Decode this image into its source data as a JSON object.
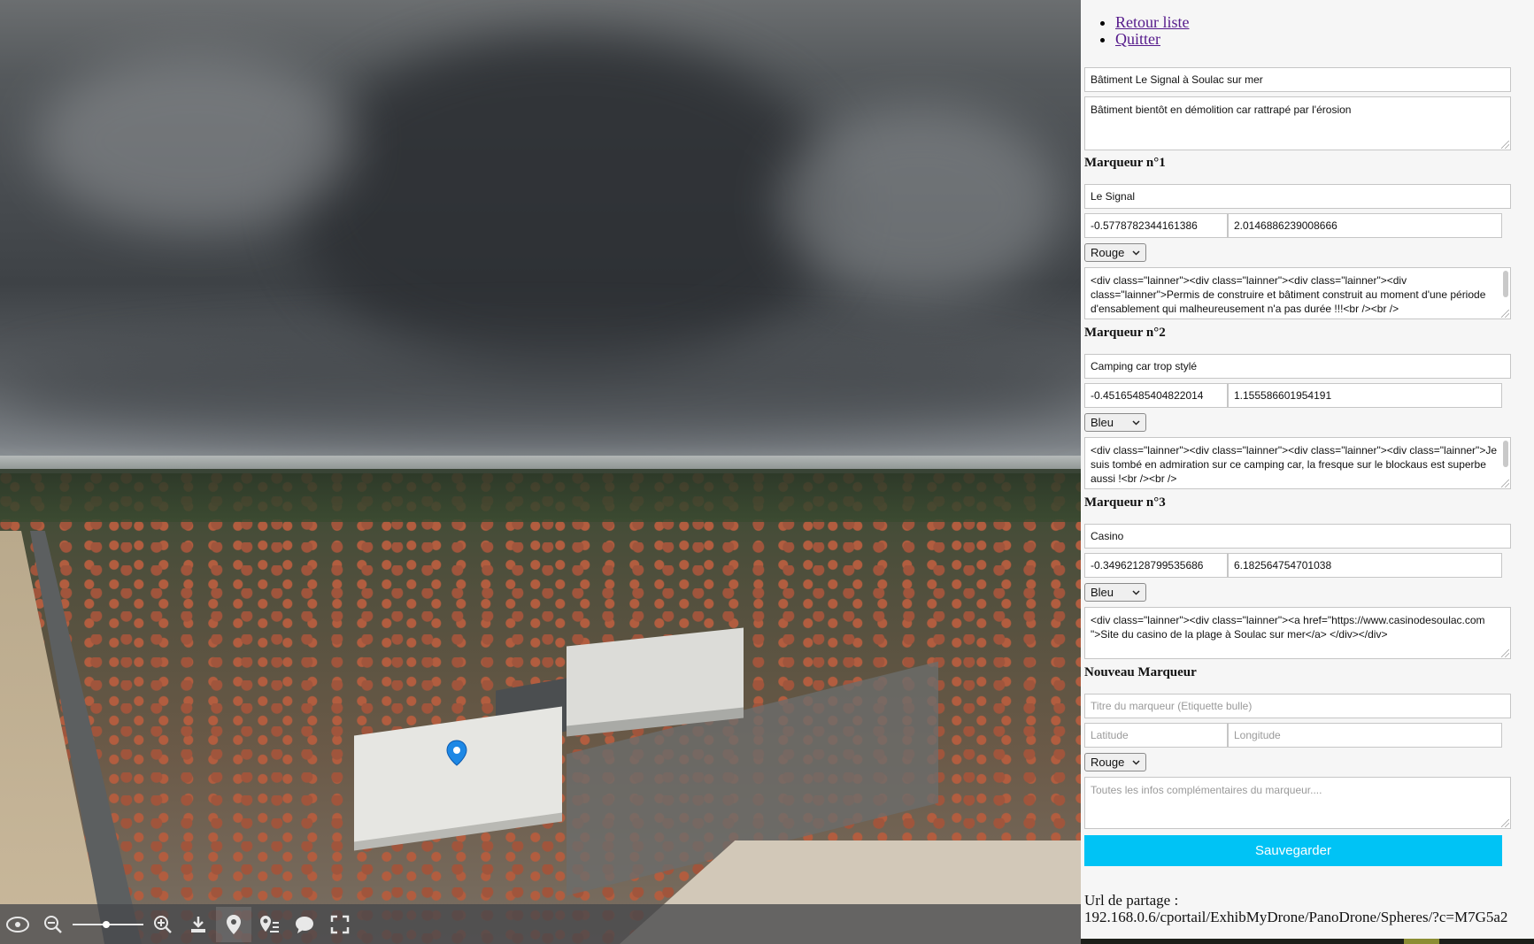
{
  "viewer": {
    "toolbar": {
      "zoom_level": 0.48
    }
  },
  "nav": {
    "items": [
      {
        "label": "Retour liste"
      },
      {
        "label": "Quitter"
      }
    ]
  },
  "form": {
    "title": "Bâtiment Le Signal à Soulac sur mer",
    "description": "Bâtiment bientôt en démolition car rattrapé par l'érosion",
    "markers": [
      {
        "heading": "Marqueur n°1",
        "name": "Le Signal",
        "latitude": "-0.5778782344161386",
        "longitude": "2.0146886239008666",
        "color": "Rouge",
        "content": "<div class=\"lainner\"><div class=\"lainner\"><div class=\"lainner\"><div class=\"lainner\">Permis de construire et bâtiment construit au moment d'une période d'ensablement qui malheureusement n'a pas durée !!!<br /><br />"
      },
      {
        "heading": "Marqueur n°2",
        "name": "Camping car trop stylé",
        "latitude": "-0.45165485404822014",
        "longitude": "1.155586601954191",
        "color": "Bleu",
        "content": "<div class=\"lainner\"><div class=\"lainner\"><div class=\"lainner\"><div class=\"lainner\">Je suis tombé en admiration sur ce camping car, la fresque sur le blockaus est superbe aussi !<br /><br />"
      },
      {
        "heading": "Marqueur n°3",
        "name": "Casino",
        "latitude": "-0.34962128799535686",
        "longitude": "6.182564754701038",
        "color": "Bleu",
        "content": "<div class=\"lainner\"><div class=\"lainner\"><a href=\"https://www.casinodesoulac.com\n\">Site du casino de la plage à Soulac sur mer</a> </div></div>"
      }
    ],
    "new_marker": {
      "heading": "Nouveau Marqueur",
      "title_placeholder": "Titre du marqueur (Etiquette bulle)",
      "lat_placeholder": "Latitude",
      "lng_placeholder": "Longitude",
      "color": "Rouge",
      "info_placeholder": "Toutes les infos complémentaires du marqueur...."
    },
    "save_label": "Sauvegarder"
  },
  "share": {
    "label": "Url de partage :",
    "url": "192.168.0.6/cportail/ExhibMyDrone/PanoDrone/Spheres/?c=M7G5a2"
  },
  "colors": {
    "accent": "#00c3f5",
    "link": "#551a8b",
    "marker_pin": "#1e88e5"
  },
  "icons": [
    "rotate-icon",
    "zoom-out-icon",
    "zoom-in-icon",
    "download-icon",
    "marker-icon",
    "marker-list-icon",
    "caption-icon",
    "fullscreen-icon"
  ]
}
